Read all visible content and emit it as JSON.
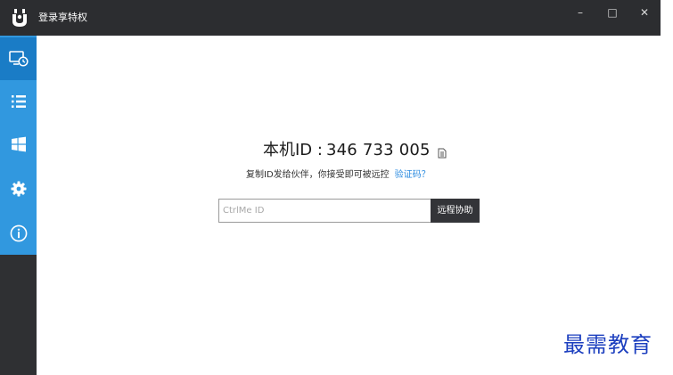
{
  "window": {
    "title": "登录享特权",
    "controls": {
      "minimize": "–",
      "maximize": "□",
      "close": "✕"
    }
  },
  "sidebar": {
    "items": [
      {
        "icon": "remote-monitor-icon",
        "active": true
      },
      {
        "icon": "list-icon",
        "active": false
      },
      {
        "icon": "windows-icon",
        "active": false
      },
      {
        "icon": "gear-icon",
        "active": false
      },
      {
        "icon": "info-icon",
        "active": false
      }
    ]
  },
  "main": {
    "machine_id_label": "本机ID :",
    "machine_id_value": "346 733 005",
    "hint_text": "复制ID发给伙伴，你接受即可被远控",
    "verify_link": "验证码？",
    "input_placeholder": "CtrlMe ID",
    "input_value": "",
    "assist_button": "远程协助"
  },
  "watermark": "最需教育",
  "colors": {
    "titlebar": "#2c2d30",
    "sidebar_blue": "#3198df",
    "sidebar_active": "#1a7cc6",
    "sidebar_dark": "#2f3033",
    "link": "#2b8be0",
    "watermark": "#1c3fbf"
  }
}
